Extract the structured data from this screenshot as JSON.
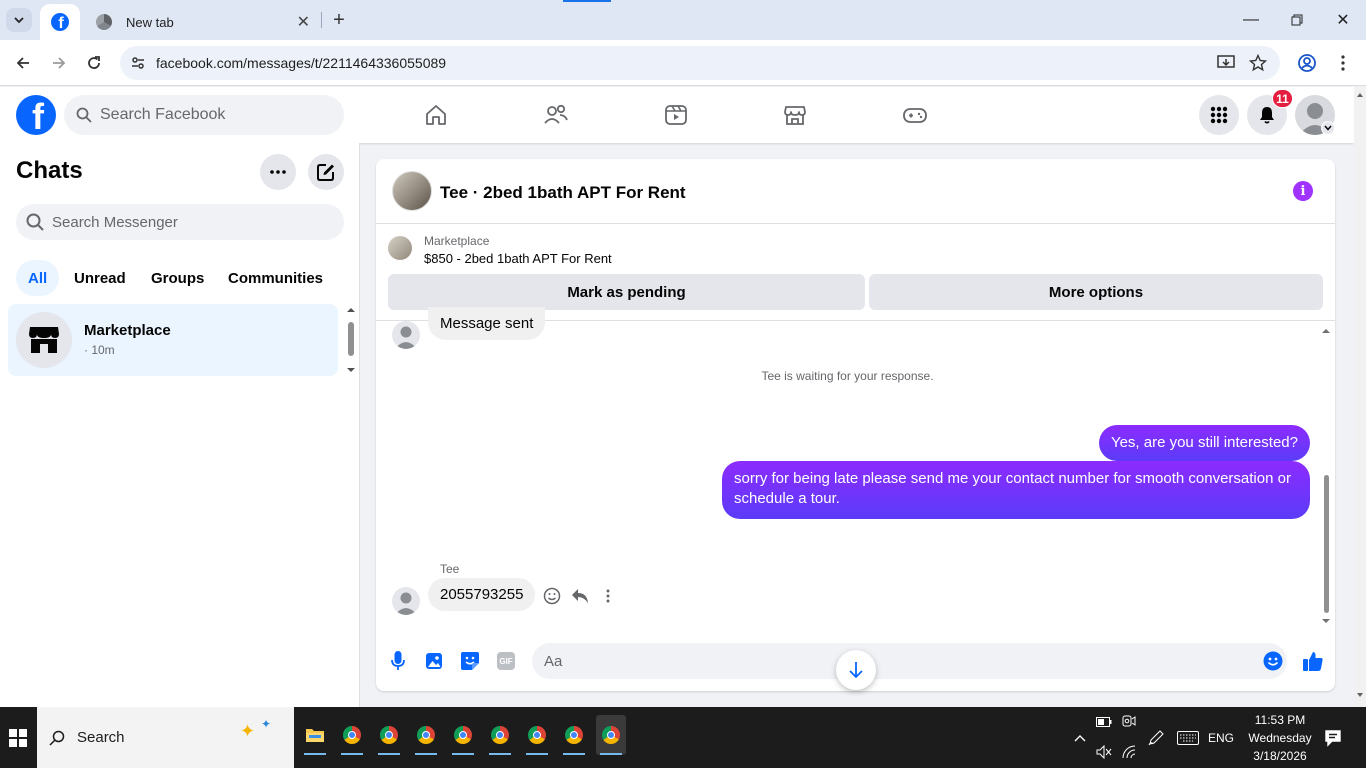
{
  "browser": {
    "tabs": [
      {
        "label": "",
        "active": true
      },
      {
        "label": "New tab",
        "active": false
      }
    ],
    "url": "facebook.com/messages/t/2211464336055089"
  },
  "facebook": {
    "search_placeholder": "Search Facebook",
    "notification_count": "11",
    "nav_icons": [
      "home-icon",
      "friends-icon",
      "video-icon",
      "marketplace-icon",
      "gaming-icon"
    ]
  },
  "sidebar": {
    "title": "Chats",
    "search_placeholder": "Search Messenger",
    "filters": [
      {
        "label": "All",
        "active": true
      },
      {
        "label": "Unread",
        "active": false
      },
      {
        "label": "Groups",
        "active": false
      },
      {
        "label": "Communities",
        "active": false
      }
    ],
    "chats": [
      {
        "name": "Marketplace",
        "time": "· 10m"
      }
    ]
  },
  "conversation": {
    "title": "Tee · 2bed 1bath APT For Rent",
    "marketplace_label": "Marketplace",
    "listing": "$850 - 2bed 1bath APT For Rent",
    "buttons": {
      "pending": "Mark as pending",
      "more": "More options"
    },
    "messages": [
      {
        "from": "them",
        "text": "Message sent"
      },
      {
        "status": "Tee is waiting for your response."
      },
      {
        "from": "me",
        "text": "Yes, are you still interested?"
      },
      {
        "from": "me",
        "text": "sorry for being late please send me your contact number for smooth conversation or schedule a tour."
      },
      {
        "from": "them",
        "sender": "Tee",
        "text": "2055793255"
      }
    ],
    "composer_placeholder": "Aa"
  },
  "taskbar": {
    "search_label": "Search",
    "language": "ENG",
    "time": "11:53 PM",
    "day": "Wednesday",
    "date": "3/18/2026"
  },
  "colors": {
    "fb_blue": "#0866ff",
    "outgoing_start": "#8c2bff",
    "outgoing_end": "#5b3cf8",
    "info_purple": "#a033ff",
    "badge_red": "#e41e3f"
  }
}
